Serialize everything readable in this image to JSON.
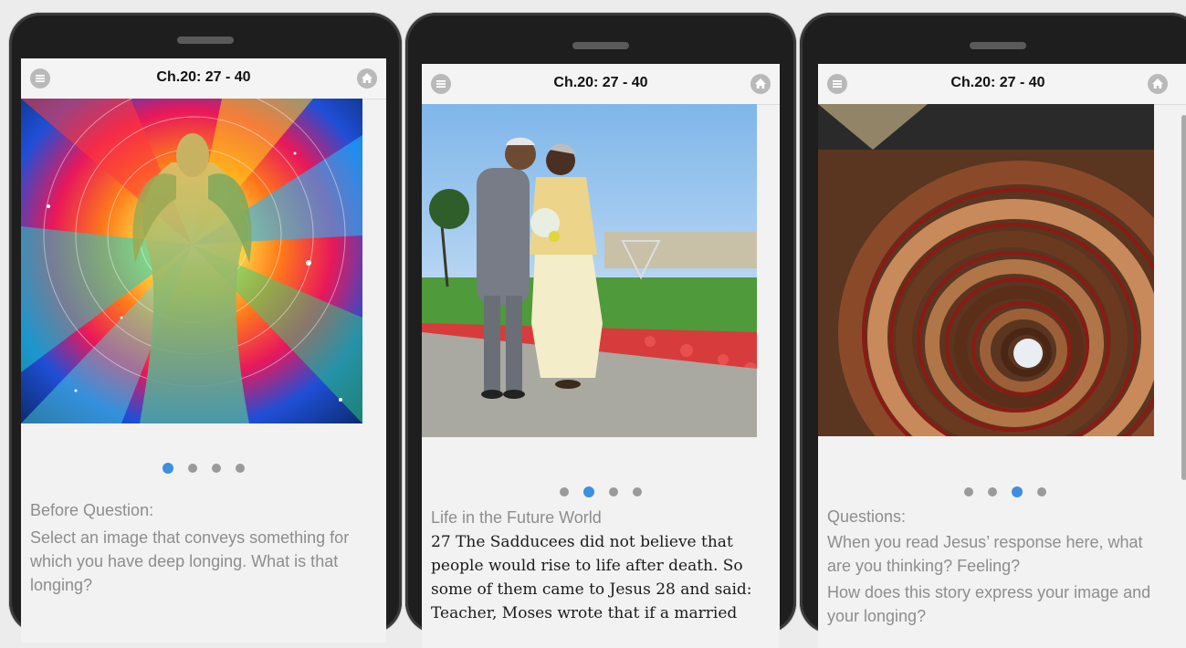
{
  "screens": [
    {
      "header_title": "Ch.20: 27 - 40",
      "section_label": "Before Question:",
      "body_text": "Select an image that conveys something for which you have deep longing. What is that longing?",
      "active_dot": 1,
      "total_dots": 4
    },
    {
      "header_title": "Ch.20: 27 - 40",
      "section_label": "Life in the Future World",
      "scripture_lines": [
        "27 The Sadducees did not believe that",
        "people would rise to life after death. So",
        "some of them came to Jesus 28 and said:",
        "Teacher, Moses wrote that if a married"
      ],
      "active_dot": 2,
      "total_dots": 4
    },
    {
      "header_title": "Ch.20: 27 - 40",
      "section_label": "Questions:",
      "question_1": "When you read Jesus’ response here, what are you thinking? Feeling?",
      "question_2": "How does this story express your image and your longing?",
      "active_dot": 3,
      "total_dots": 4
    }
  ],
  "icons": {
    "menu": "menu-icon",
    "home": "home-icon"
  },
  "colors": {
    "dot_active": "#3d8fe0",
    "dot_inactive": "#9a9a9a",
    "phone_body": "#1e1e1e",
    "screen_bg": "#f2f2f2"
  }
}
